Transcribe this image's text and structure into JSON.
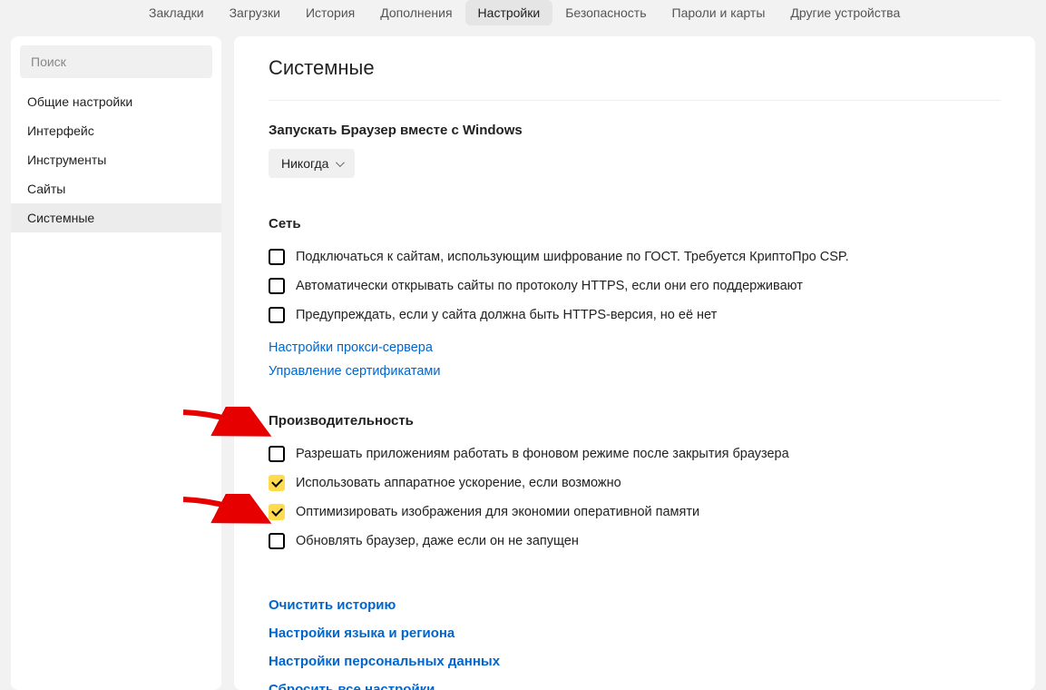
{
  "topnav": {
    "items": [
      {
        "label": "Закладки"
      },
      {
        "label": "Загрузки"
      },
      {
        "label": "История"
      },
      {
        "label": "Дополнения"
      },
      {
        "label": "Настройки",
        "active": true
      },
      {
        "label": "Безопасность"
      },
      {
        "label": "Пароли и карты"
      },
      {
        "label": "Другие устройства"
      }
    ]
  },
  "sidebar": {
    "search_placeholder": "Поиск",
    "items": [
      {
        "label": "Общие настройки"
      },
      {
        "label": "Интерфейс"
      },
      {
        "label": "Инструменты"
      },
      {
        "label": "Сайты"
      },
      {
        "label": "Системные",
        "active": true
      }
    ]
  },
  "main": {
    "title": "Системные",
    "launch": {
      "heading": "Запускать Браузер вместе с Windows",
      "dropdown": "Никогда"
    },
    "network": {
      "heading": "Сеть",
      "checks": [
        {
          "label": "Подключаться к сайтам, использующим шифрование по ГОСТ. Требуется КриптоПро CSP.",
          "checked": false
        },
        {
          "label": "Автоматически открывать сайты по протоколу HTTPS, если они его поддерживают",
          "checked": false
        },
        {
          "label": "Предупреждать, если у сайта должна быть HTTPS-версия, но её нет",
          "checked": false
        }
      ],
      "links": [
        {
          "label": "Настройки прокси-сервера"
        },
        {
          "label": "Управление сертификатами"
        }
      ]
    },
    "performance": {
      "heading": "Производительность",
      "checks": [
        {
          "label": "Разрешать приложениям работать в фоновом режиме после закрытия браузера",
          "checked": false
        },
        {
          "label": "Использовать аппаратное ускорение, если возможно",
          "checked": true
        },
        {
          "label": "Оптимизировать изображения для экономии оперативной памяти",
          "checked": true
        },
        {
          "label": "Обновлять браузер, даже если он не запущен",
          "checked": false
        }
      ]
    },
    "footer_links": [
      {
        "label": "Очистить историю"
      },
      {
        "label": "Настройки языка и региона"
      },
      {
        "label": "Настройки персональных данных"
      },
      {
        "label": "Сбросить все настройки"
      }
    ]
  }
}
